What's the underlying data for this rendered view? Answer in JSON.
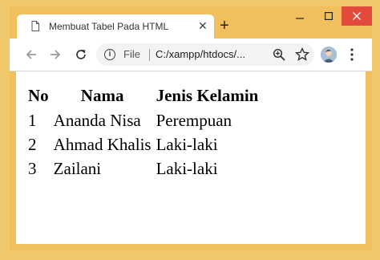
{
  "tab": {
    "title": "Membuat Tabel Pada HTML",
    "close_label": "✕"
  },
  "newtab_label": "+",
  "window_controls": {
    "minimize": "–",
    "maximize": "□",
    "close": "✕",
    "close_color": "#e24a3b"
  },
  "toolbar": {
    "scheme_label": "File",
    "url": "C:/xampp/htdocs/..."
  },
  "icons": {
    "tab": "document-icon",
    "back": "back-arrow-icon",
    "forward": "forward-arrow-icon",
    "reload": "reload-icon",
    "info": "info-icon",
    "zoom": "zoom-icon",
    "star": "star-icon",
    "avatar": "avatar",
    "menu": "menu-dots-icon"
  },
  "colors": {
    "frame": "#f0c05f",
    "close_button": "#e24a3b"
  },
  "table": {
    "headers": [
      "No",
      "Nama",
      "Jenis Kelamin"
    ],
    "rows": [
      [
        "1",
        "Ananda Nisa",
        "Perempuan"
      ],
      [
        "2",
        "Ahmad Khalis",
        "Laki-laki"
      ],
      [
        "3",
        "Zailani",
        "Laki-laki"
      ]
    ]
  }
}
